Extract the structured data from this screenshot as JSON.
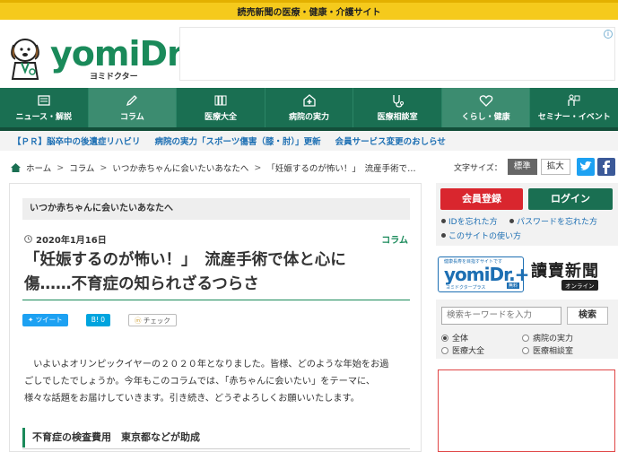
{
  "topbar": {
    "text": "読売新聞の医療・健康・介護サイト"
  },
  "logo": {
    "word": "yomiDr.",
    "kana": "ヨミドクター"
  },
  "nav": [
    {
      "label": "ニュース・解説",
      "icon": "newspaper-icon"
    },
    {
      "label": "コラム",
      "icon": "pen-icon"
    },
    {
      "label": "医療大全",
      "icon": "books-icon"
    },
    {
      "label": "病院の実力",
      "icon": "hospital-icon"
    },
    {
      "label": "医療相談室",
      "icon": "stethoscope-icon"
    },
    {
      "label": "くらし・健康",
      "icon": "heart-icon"
    },
    {
      "label": "セミナー・イベント",
      "icon": "presenter-icon"
    }
  ],
  "newsbar": [
    "【ＰＲ】脳卒中の後遺症リハビリ",
    "病院の実力「スポーツ傷害（膝・肘）」更新",
    "会員サービス変更のおしらせ"
  ],
  "breadcrumb": [
    "ホーム",
    "コラム",
    "いつか赤ちゃんに会いたいあなたへ",
    "「妊娠するのが怖い！」　流産手術で…"
  ],
  "fontsize": {
    "label": "文字サイズ：",
    "standard": "標準",
    "large": "拡大"
  },
  "article": {
    "series": "いつか赤ちゃんに会いたいあなたへ",
    "date": "2020年1月16日",
    "category": "コラム",
    "title_line1": "「妊娠するのが怖い！」　流産手術で体と心に",
    "title_line2": "傷……不育症の知られざるつらさ",
    "share_tweet": "ツイート",
    "share_hatena_count": "0",
    "share_mixi": "チェック",
    "body_line1": "　いよいよオリンピックイヤーの２０２０年となりました。皆様、どのような年始をお過",
    "body_line2": "ごしでしたでしょうか。今年もこのコラムでは、「赤ちゃんに会いたい」をテーマに、",
    "body_line3": "様々な話題をお届けしていきます。引き続き、どうぞよろしくお願いいたします。",
    "subhead": "不育症の検査費用　東京都などが助成"
  },
  "sidebar": {
    "register": "会員登録",
    "login": "ログイン",
    "forgot_id": "IDを忘れた方",
    "forgot_pw": "パスワードを忘れた方",
    "howto": "このサイトの使い方",
    "banner1_top": "健康長寿を目指すサイトです",
    "banner1_name": "yomiDr.+",
    "banner1_sub": "ヨミドクタープラス",
    "banner1_tag": "無料",
    "banner2_name": "讀賣新聞",
    "banner2_tag": "オンライン",
    "search_placeholder": "検索キーワードを入力",
    "search_button": "検索",
    "radio_all": "全体",
    "radio_hospital": "病院の実力",
    "radio_encyclopedia": "医療大全",
    "radio_consult": "医療相談室"
  },
  "colors": {
    "brand_green": "#1a6f52",
    "topbar_yellow": "#f5ca1c",
    "register_red": "#d9262e",
    "link_blue": "#1d6fb3"
  }
}
